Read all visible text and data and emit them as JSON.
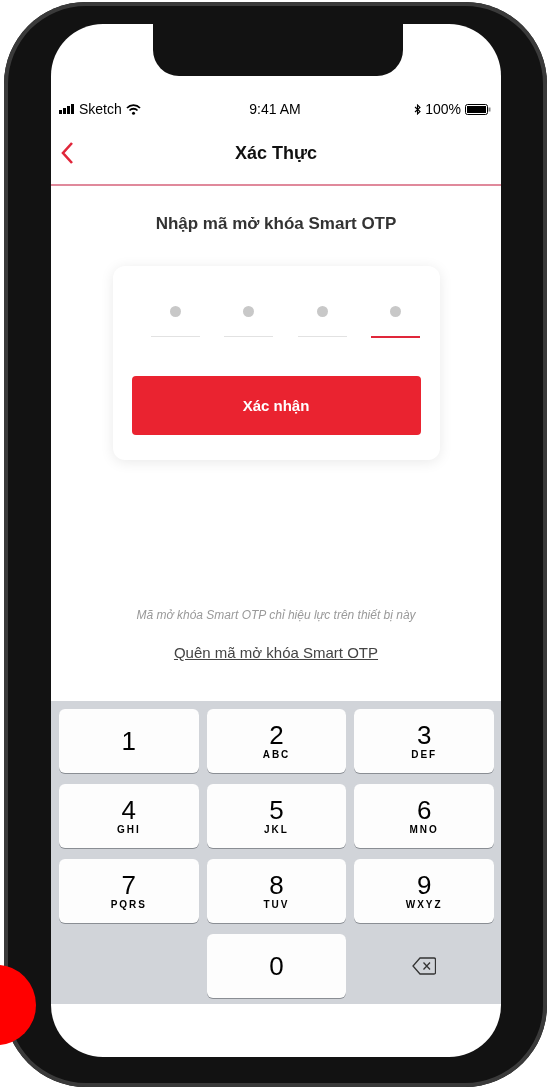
{
  "status_bar": {
    "carrier": "Sketch",
    "time": "9:41 AM",
    "battery": "100%"
  },
  "header": {
    "title": "Xác Thực"
  },
  "heading": "Nhập mã mở khóa Smart OTP",
  "pin_slots": [
    {
      "selected": false
    },
    {
      "selected": false
    },
    {
      "selected": false
    },
    {
      "selected": true
    }
  ],
  "confirm_button": "Xác nhận",
  "hint": "Mã mở khóa Smart OTP chỉ hiệu lực trên thiết bị này",
  "forgot_link": "Quên mã mở khóa Smart OTP",
  "keypad": [
    {
      "kind": "digit",
      "digit": "1"
    },
    {
      "kind": "digit",
      "digit": "2",
      "letters": "ABC"
    },
    {
      "kind": "digit",
      "digit": "3",
      "letters": "DEF"
    },
    {
      "kind": "digit",
      "digit": "4",
      "letters": "GHI"
    },
    {
      "kind": "digit",
      "digit": "5",
      "letters": "JKL"
    },
    {
      "kind": "digit",
      "digit": "6",
      "letters": "MNO"
    },
    {
      "kind": "digit",
      "digit": "7",
      "letters": "PQRS"
    },
    {
      "kind": "digit",
      "digit": "8",
      "letters": "TUV"
    },
    {
      "kind": "digit",
      "digit": "9",
      "letters": "WXYZ"
    },
    {
      "kind": "blank"
    },
    {
      "kind": "digit",
      "digit": "0"
    },
    {
      "kind": "backspace"
    }
  ]
}
